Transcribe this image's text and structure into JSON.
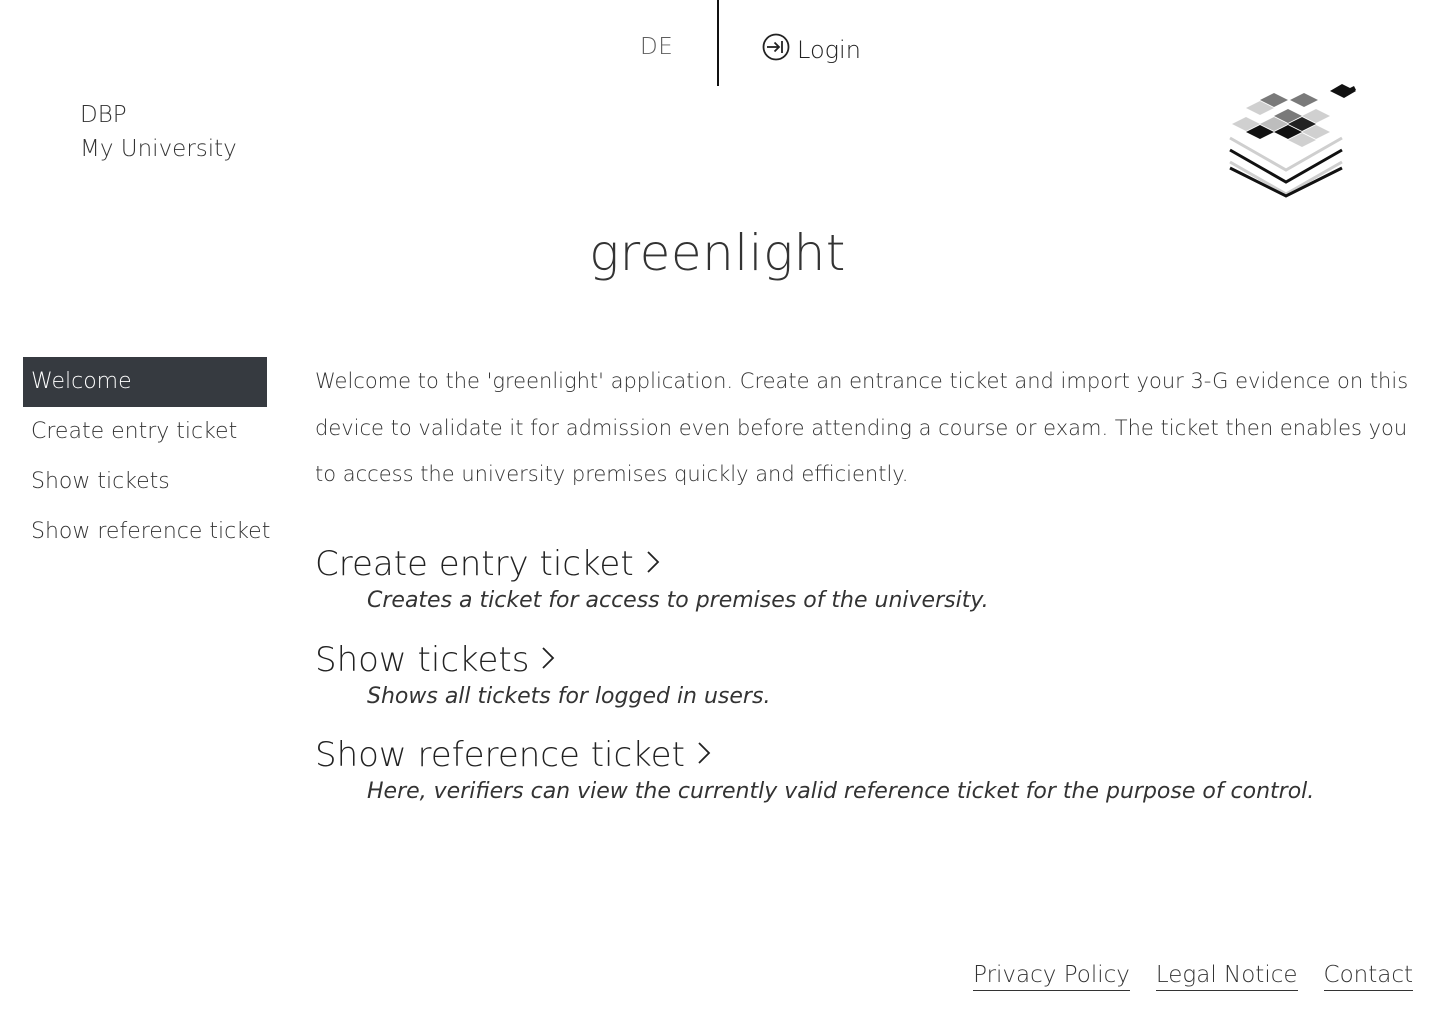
{
  "header": {
    "language_toggle": "DE",
    "login_label": "Login",
    "org_line1": "DBP",
    "org_line2": "My University"
  },
  "app_title": "greenlight",
  "sidebar": {
    "items": [
      {
        "label": "Welcome",
        "active": true
      },
      {
        "label": "Create entry ticket",
        "active": false
      },
      {
        "label": "Show tickets",
        "active": false
      },
      {
        "label": "Show reference ticket",
        "active": false
      }
    ]
  },
  "main": {
    "intro": "Welcome to the 'greenlight' application. Create an entrance ticket and import your 3-G evidence on this device to validate it for admission even before attending a course or exam. The ticket then enables you to access the university premises quickly and efficiently.",
    "features": [
      {
        "title": "Create entry ticket",
        "description": "Creates a ticket for access to premises of the university."
      },
      {
        "title": "Show tickets",
        "description": "Shows all tickets for logged in users."
      },
      {
        "title": "Show reference ticket",
        "description": "Here, verifiers can view the currently valid reference ticket for the purpose of control."
      }
    ]
  },
  "footer": {
    "links": [
      "Privacy Policy",
      "Legal Notice",
      "Contact"
    ]
  },
  "icons": {
    "login": "login-icon",
    "chevron": "chevron-right-icon",
    "logo": "cube-stack-logo"
  },
  "colors": {
    "active_nav_bg": "#363a40",
    "active_nav_text": "#ffffff",
    "text": "#333333"
  }
}
